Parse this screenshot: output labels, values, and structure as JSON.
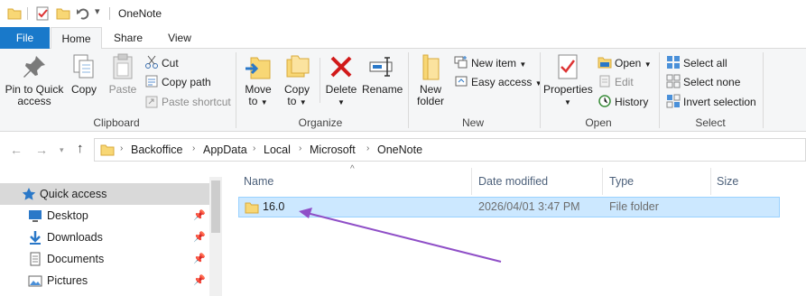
{
  "window": {
    "title": "OneNote"
  },
  "tabs": {
    "file": "File",
    "home": "Home",
    "share": "Share",
    "view": "View"
  },
  "ribbon": {
    "clipboard": {
      "label": "Clipboard",
      "pin_line1": "Pin to Quick",
      "pin_line2": "access",
      "copy": "Copy",
      "paste": "Paste",
      "cut": "Cut",
      "copy_path": "Copy path",
      "paste_shortcut": "Paste shortcut"
    },
    "organize": {
      "label": "Organize",
      "move_to": "Move",
      "move_to_2": "to",
      "copy_to": "Copy",
      "copy_to_2": "to",
      "delete": "Delete",
      "rename": "Rename"
    },
    "new": {
      "label": "New",
      "new_folder_1": "New",
      "new_folder_2": "folder",
      "new_item": "New item",
      "easy_access": "Easy access"
    },
    "open": {
      "label": "Open",
      "properties": "Properties",
      "open": "Open",
      "edit": "Edit",
      "history": "History"
    },
    "select": {
      "label": "Select",
      "select_all": "Select all",
      "select_none": "Select none",
      "invert": "Invert selection"
    }
  },
  "address": {
    "crumbs": [
      "Backoffice",
      "AppData",
      "Local",
      "Microsoft",
      "OneNote"
    ]
  },
  "nav": {
    "quick_access": "Quick access",
    "items": [
      {
        "label": "Desktop"
      },
      {
        "label": "Downloads"
      },
      {
        "label": "Documents"
      },
      {
        "label": "Pictures"
      }
    ]
  },
  "columns": {
    "name": "Name",
    "date": "Date modified",
    "type": "Type",
    "size": "Size"
  },
  "files": [
    {
      "name": "16.0",
      "date": "2026/04/01 3:47 PM",
      "type": "File folder",
      "size": ""
    }
  ],
  "colors": {
    "accent": "#1979ca",
    "selection": "#cce8ff",
    "arrow": "#8f4fc7",
    "folder": "#f8d775"
  }
}
